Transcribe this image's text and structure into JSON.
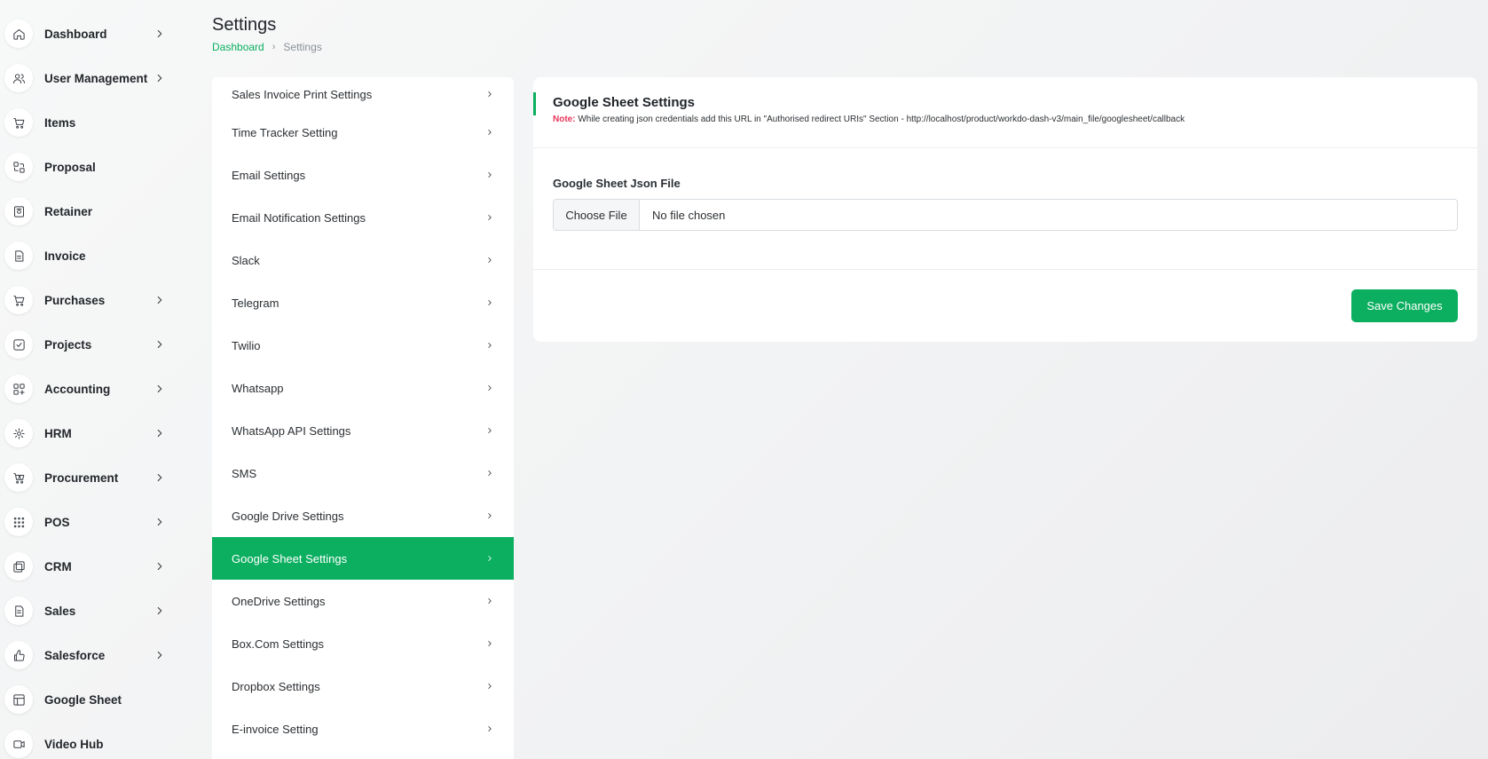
{
  "sidebar": {
    "items": [
      {
        "label": "Dashboard",
        "icon": "home-icon",
        "has_submenu": true
      },
      {
        "label": "User Management",
        "icon": "users-icon",
        "has_submenu": true
      },
      {
        "label": "Items",
        "icon": "cart-icon",
        "has_submenu": false
      },
      {
        "label": "Proposal",
        "icon": "proposal-icon",
        "has_submenu": false
      },
      {
        "label": "Retainer",
        "icon": "retainer-icon",
        "has_submenu": false
      },
      {
        "label": "Invoice",
        "icon": "invoice-icon",
        "has_submenu": false
      },
      {
        "label": "Purchases",
        "icon": "cart-icon",
        "has_submenu": true
      },
      {
        "label": "Projects",
        "icon": "check-square-icon",
        "has_submenu": true
      },
      {
        "label": "Accounting",
        "icon": "apps-icon",
        "has_submenu": true
      },
      {
        "label": "HRM",
        "icon": "hrm-icon",
        "has_submenu": true
      },
      {
        "label": "Procurement",
        "icon": "procurement-icon",
        "has_submenu": true
      },
      {
        "label": "POS",
        "icon": "grid-dots-icon",
        "has_submenu": true
      },
      {
        "label": "CRM",
        "icon": "crm-icon",
        "has_submenu": true
      },
      {
        "label": "Sales",
        "icon": "file-icon",
        "has_submenu": true
      },
      {
        "label": "Salesforce",
        "icon": "thumbs-up-icon",
        "has_submenu": true
      },
      {
        "label": "Google Sheet",
        "icon": "table-icon",
        "has_submenu": false
      },
      {
        "label": "Video Hub",
        "icon": "video-icon",
        "has_submenu": false
      }
    ]
  },
  "header": {
    "title": "Settings",
    "breadcrumb": {
      "home": "Dashboard",
      "current": "Settings"
    }
  },
  "settings_menu": {
    "active_index": 11,
    "items": [
      "Sales Invoice Print Settings",
      "Time Tracker Setting",
      "Email Settings",
      "Email Notification Settings",
      "Slack",
      "Telegram",
      "Twilio",
      "Whatsapp",
      "WhatsApp API Settings",
      "SMS",
      "Google Drive Settings",
      "Google Sheet Settings",
      "OneDrive Settings",
      "Box.Com Settings",
      "Dropbox Settings",
      "E-invoice Setting"
    ]
  },
  "card": {
    "title": "Google Sheet Settings",
    "note_label": "Note:",
    "note_text": "While creating json credentials add this URL in \"Authorised redirect URIs\" Section - http://localhost/product/workdo-dash-v3/main_file/googlesheet/callback",
    "field_label": "Google Sheet Json File",
    "file_button": "Choose File",
    "file_status": "No file chosen",
    "save_label": "Save Changes"
  },
  "colors": {
    "accent": "#0caf60",
    "note": "#e8355a"
  }
}
